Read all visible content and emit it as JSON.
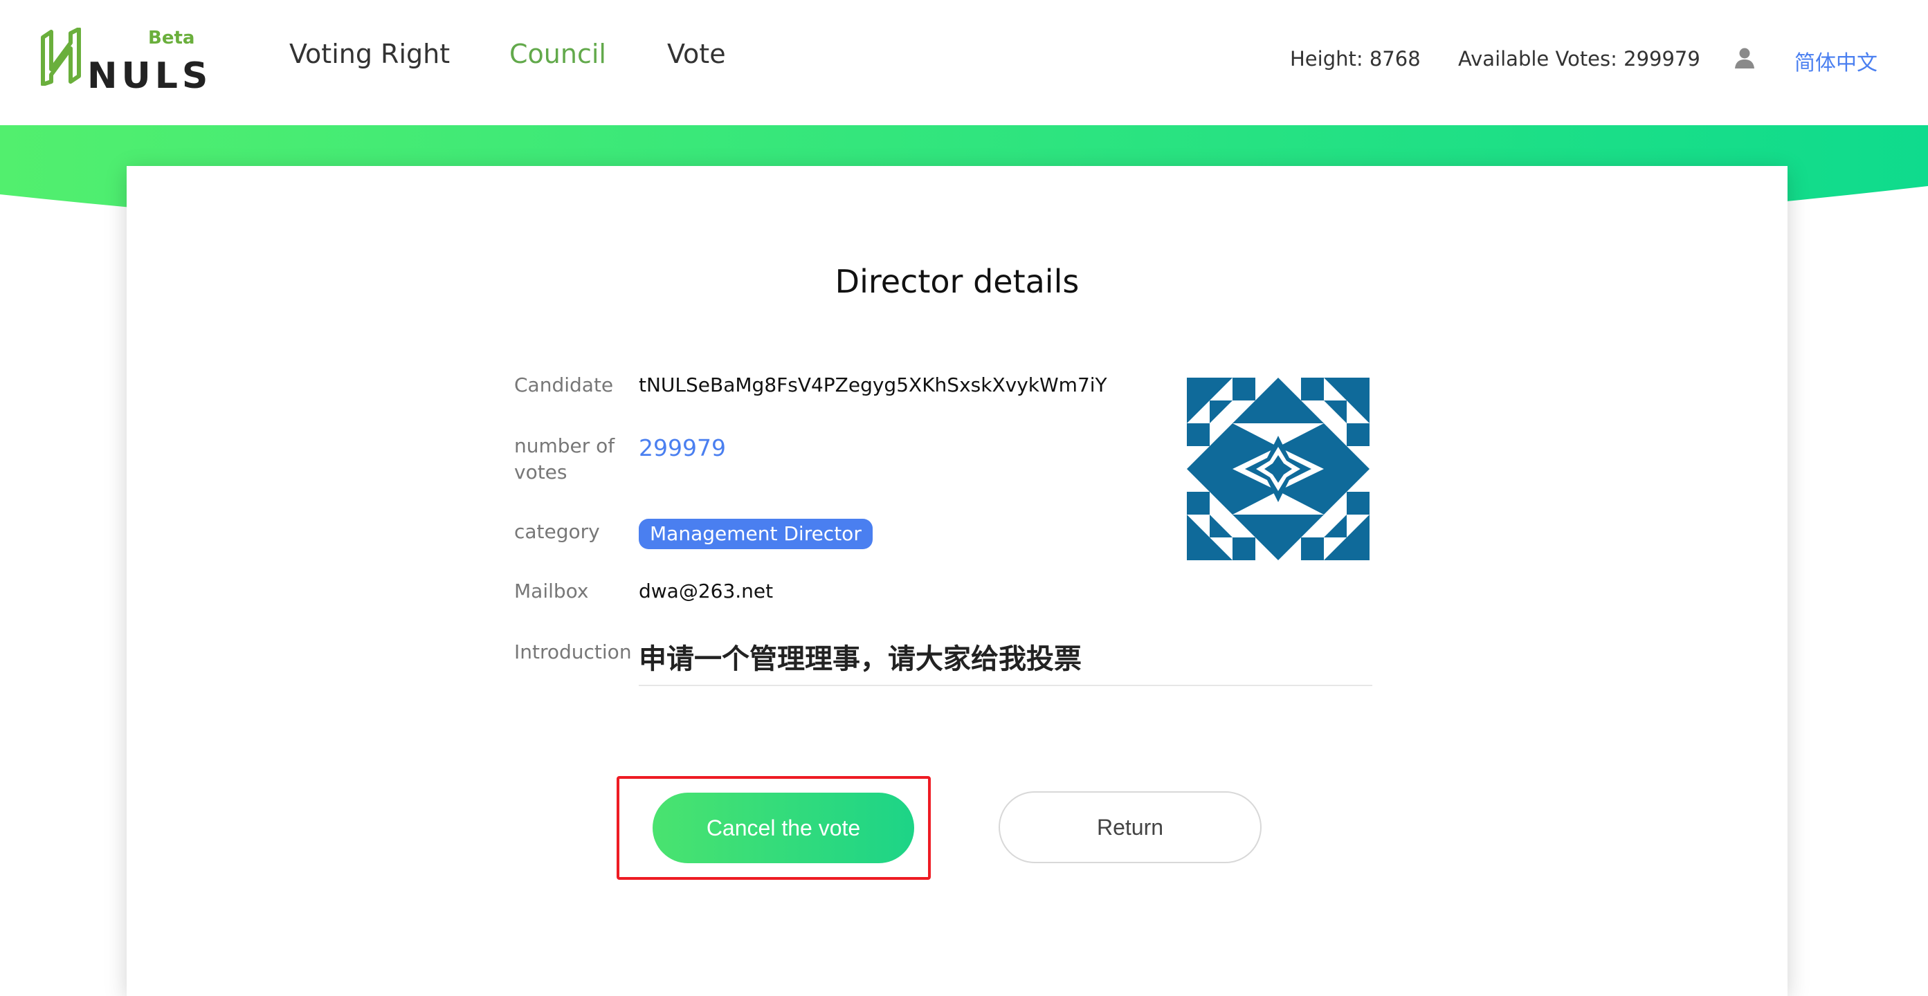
{
  "header": {
    "logo_text": "NULS",
    "logo_badge": "Beta",
    "nav": [
      {
        "label": "Voting Right"
      },
      {
        "label": "Council"
      },
      {
        "label": "Vote"
      }
    ],
    "active_nav": "Council",
    "height_text": "Height: 8768",
    "available_votes_text": "Available Votes: 299979",
    "user_icon": "user-icon",
    "language": "简体中文"
  },
  "colors": {
    "brand_green": "#62a94b",
    "gradient_start": "#4ae36f",
    "gradient_end": "#1dd487",
    "link_blue": "#4a7ff0",
    "highlight_red": "#ee1c24",
    "avatar_blue": "#0f6a9a"
  },
  "details": {
    "title": "Director details",
    "candidate_label": "Candidate",
    "candidate_value": "tNULSeBaMg8FsV4PZegyg5XKhSxskXvykWm7iY",
    "votes_label": "number of votes",
    "votes_value": "299979",
    "category_label": "category",
    "category_value": "Management Director",
    "mailbox_label": "Mailbox",
    "mailbox_value": "dwa@263.net",
    "intro_label": "Introduction",
    "intro_value": "申请一个管理理事，请大家给我投票"
  },
  "actions": {
    "cancel_label": "Cancel the vote",
    "return_label": "Return"
  }
}
